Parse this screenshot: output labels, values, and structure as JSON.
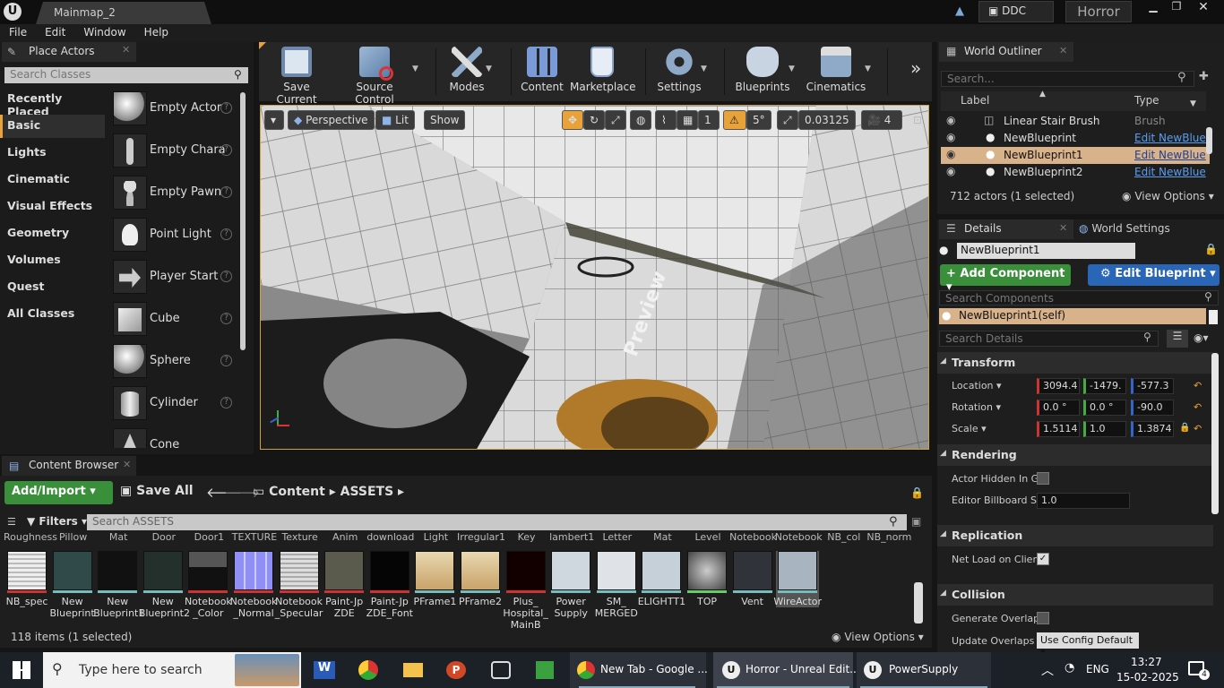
{
  "titlebar": {
    "tab": "Mainmap_2",
    "ddc": "DDC",
    "project": "Horror"
  },
  "menu": [
    "File",
    "Edit",
    "Window",
    "Help"
  ],
  "place_actors": {
    "title": "Place Actors",
    "search_placeholder": "Search Classes",
    "categories": [
      "Recently Placed",
      "Basic",
      "Lights",
      "Cinematic",
      "Visual Effects",
      "Geometry",
      "Volumes",
      "Quest",
      "All Classes"
    ],
    "actors": [
      "Empty Actor",
      "Empty Chara",
      "Empty Pawn",
      "Point Light",
      "Player Start",
      "Cube",
      "Sphere",
      "Cylinder",
      "Cone"
    ]
  },
  "toolbar": {
    "buttons": [
      "Save Current",
      "Source Control",
      "Modes",
      "Content",
      "Marketplace",
      "Settings",
      "Blueprints",
      "Cinematics"
    ]
  },
  "viewport": {
    "perspective": "Perspective",
    "lit": "Lit",
    "show": "Show",
    "grid": "1",
    "angle": "5°",
    "scale": "0.03125",
    "camspeed": "4",
    "watermark": "Preview"
  },
  "content_browser": {
    "title": "Content Browser",
    "add_import": "Add/Import",
    "save_all": "Save All",
    "path": [
      "Content",
      "ASSETS"
    ],
    "filters": "Filters",
    "search_placeholder": "Search ASSETS",
    "top_labels": [
      "Couch_ Roughness",
      "Pillow",
      "Mat",
      "Door",
      "Door1",
      "Colour_ TEXTURE",
      "Texture",
      "Anim",
      "download",
      "Light",
      "Irregular1",
      "Key",
      "lambert1",
      "Letter",
      "Mat",
      "Level",
      "Old_ Notebook",
      "Old_ Notebook",
      "NB_col",
      "NB_norm"
    ],
    "assets": [
      "NB_spec",
      "New Blueprint",
      "New Blueprint1",
      "New Blueprint2",
      "Notebook _Color",
      "Notebook _Normal",
      "Notebook _Specular",
      "Paint-Jp ZDE",
      "Paint-Jp ZDE_Font",
      "PFrame1",
      "PFrame2",
      "Plus_ Hospital_ MainB",
      "Power Supply",
      "SM_ MERGED",
      "ELIGHTT1",
      "TOP",
      "Vent",
      "WireActor"
    ],
    "status": "118 items (1 selected)",
    "view_options": "View Options"
  },
  "outliner": {
    "title": "World Outliner",
    "search_placeholder": "Search...",
    "col_label": "Label",
    "col_type": "Type",
    "rows": [
      {
        "label": "Linear Stair Brush",
        "type": "Brush"
      },
      {
        "label": "NewBlueprint",
        "type": "Edit NewBlue"
      },
      {
        "label": "NewBlueprint1",
        "type": "Edit NewBlue"
      },
      {
        "label": "NewBlueprint2",
        "type": "Edit NewBlue"
      }
    ],
    "status": "712 actors (1 selected)",
    "view_options": "View Options"
  },
  "details": {
    "tab": "Details",
    "tab2": "World Settings",
    "name": "NewBlueprint1",
    "add_component": "+ Add Component",
    "edit_blueprint": "Edit Blueprint",
    "search_components": "Search Components",
    "self": "NewBlueprint1(self)",
    "search_details": "Search Details",
    "transform": "Transform",
    "location_label": "Location",
    "location": [
      "3094.4",
      "-1479.",
      "-577.3"
    ],
    "rotation_label": "Rotation",
    "rotation": [
      "0.0 °",
      "0.0 °",
      "-90.0"
    ],
    "scale_label": "Scale",
    "scale": [
      "1.5114",
      "1.0",
      "1.3874"
    ],
    "rendering": "Rendering",
    "actor_hidden": "Actor Hidden In Ga",
    "billboard": "Editor Billboard Sc",
    "billboard_val": "1.0",
    "replication": "Replication",
    "net_load": "Net Load on Client",
    "collision": "Collision",
    "gen_overlap": "Generate Overlap",
    "update_overlaps": "Update Overlaps M",
    "update_overlaps_val": "Use Config Default"
  },
  "taskbar": {
    "search": "Type here to search",
    "apps": [
      "New Tab - Google ...",
      "Horror - Unreal Edit...",
      "PowerSupply"
    ],
    "lang": "ENG",
    "time": "13:27",
    "date": "15-02-2025",
    "notif": "4"
  }
}
